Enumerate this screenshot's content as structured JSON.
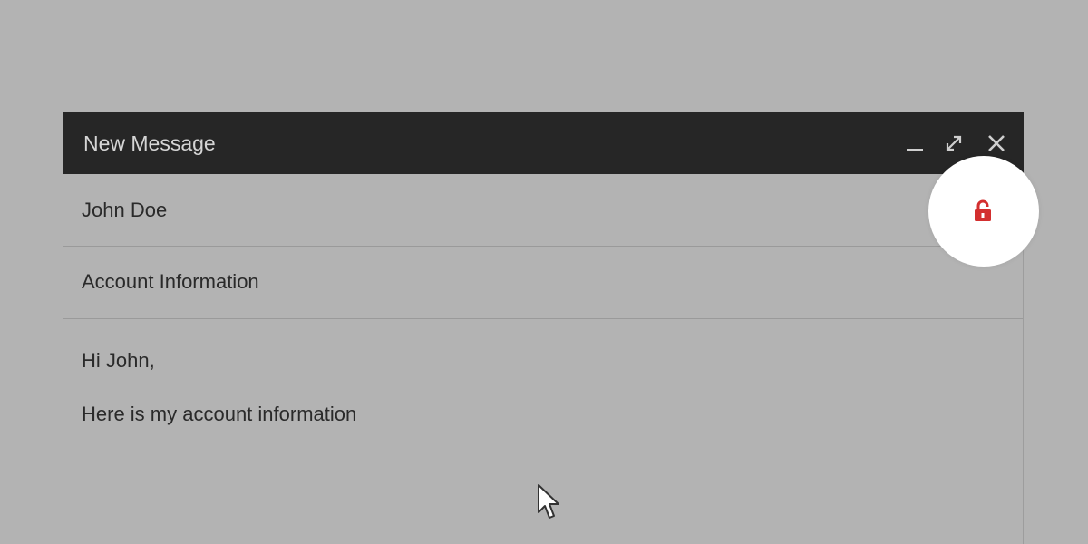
{
  "window": {
    "title": "New Message"
  },
  "compose": {
    "to": "John Doe",
    "subject": "Account Information",
    "body_lines": [
      "Hi John,",
      "Here is my account information"
    ]
  },
  "icons": {
    "minimize": "minimize-icon",
    "expand": "expand-icon",
    "close": "close-icon",
    "lock": "unlocked-padlock-icon",
    "cursor": "mouse-pointer-icon"
  },
  "colors": {
    "background": "#b3b3b3",
    "titlebar": "#262626",
    "lock_accent": "#d32f2f"
  }
}
